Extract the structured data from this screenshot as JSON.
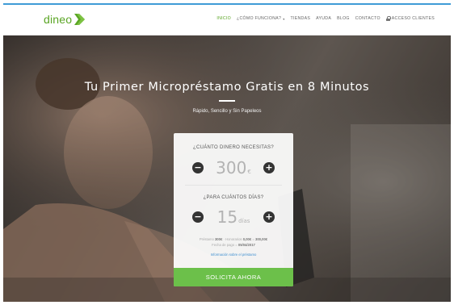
{
  "brand": {
    "name": "dineo",
    "accent": "#5aa524"
  },
  "nav": {
    "items": [
      {
        "label": "INICIO",
        "active": true
      },
      {
        "label": "¿CÓMO FUNCIONA?",
        "active": false,
        "caret": "▾"
      },
      {
        "label": "TIENDAS",
        "active": false
      },
      {
        "label": "AYUDA",
        "active": false
      },
      {
        "label": "BLOG",
        "active": false
      },
      {
        "label": "CONTACTO",
        "active": false
      }
    ],
    "client_access": {
      "label": "ACCESO CLIENTES",
      "icon": "lock-icon"
    }
  },
  "hero": {
    "title": "Tu Primer Micropréstamo Gratis en 8 Minutos",
    "subtitle": "Rápido, Sencillo y Sin Papeleos"
  },
  "calculator": {
    "amount_question": "¿CUÁNTO DINERO NECESITAS?",
    "amount_value": "300",
    "amount_unit": "€",
    "days_question": "¿PARA CUÁNTOS DÍAS?",
    "days_value": "15",
    "days_unit": "días",
    "minus_symbol": "−",
    "plus_symbol": "+",
    "summary": {
      "loan_label": "Préstamo",
      "loan_value": "300€",
      "fees_label": "Honorarios",
      "fees_value": "0,00€",
      "total_label": "Total",
      "total_value": "300,00€",
      "payment_date_label": "Fecha de pago",
      "payment_date_value": "05/04/2017"
    },
    "info_link": "Información sobre el préstamo",
    "cta_label": "SOLICITA AHORA"
  }
}
